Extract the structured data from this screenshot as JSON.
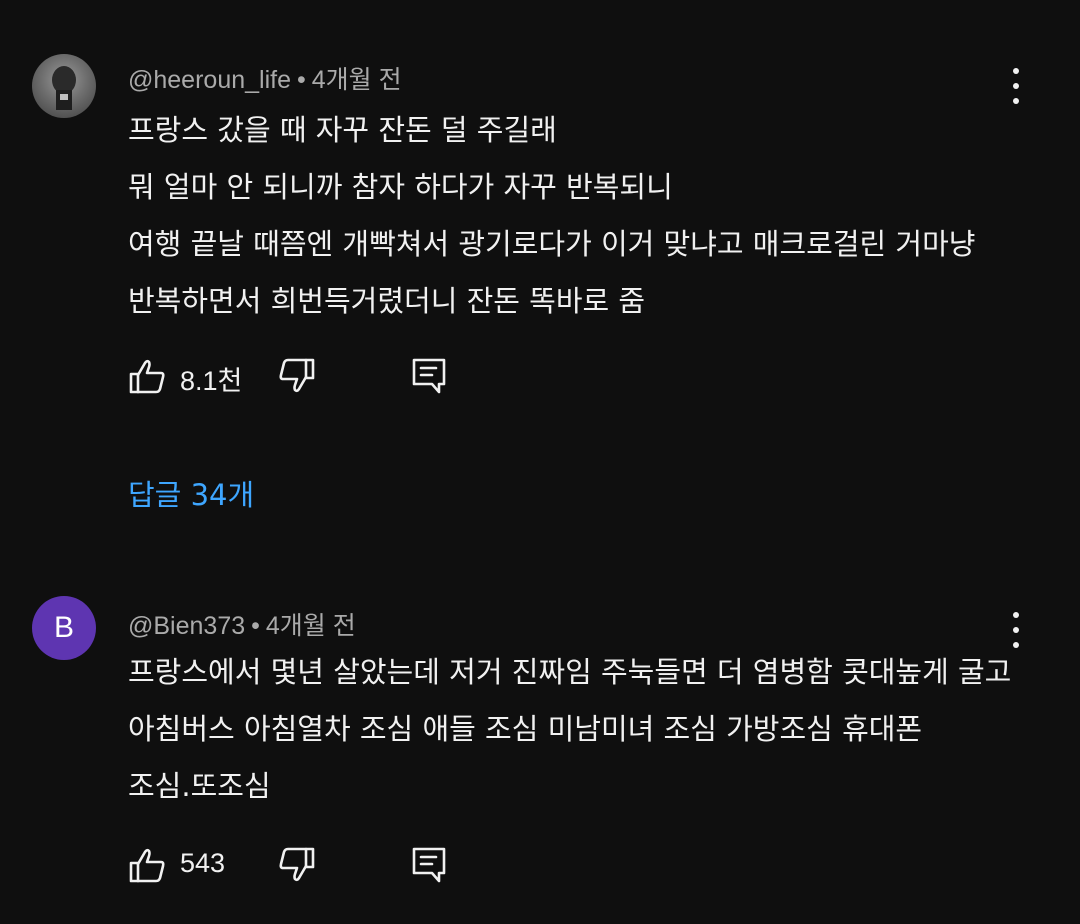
{
  "comments": [
    {
      "avatar": {
        "type": "photo"
      },
      "author": "@heeroun_life",
      "separator": "•",
      "time": "4개월 전",
      "lines": [
        "프랑스 갔을 때 자꾸 잔돈 덜 주길래",
        "뭐 얼마 안 되니까 참자 하다가 자꾸 반복되니",
        "여행 끝날 때쯤엔 개빡쳐서 광기로다가 이거 맞냐고 매크로걸린 거마냥",
        "반복하면서 희번득거렸더니 잔돈 똑바로 줌"
      ],
      "like_count": "8.1천",
      "icons": {
        "like": "thumbs-up-icon",
        "dislike": "thumbs-down-icon",
        "reply": "comment-icon",
        "menu": "more-vert-icon"
      }
    },
    {
      "avatar": {
        "type": "letter",
        "letter": "B",
        "color": "#5e35b1"
      },
      "author": "@Bien373",
      "separator": "•",
      "time": "4개월 전",
      "lines": [
        "프랑스에서 몇년 살았는데 저거 진짜임 주눅들면 더 염병함 콧대높게 굴고",
        "아침버스 아침열차 조심 애들 조심 미남미녀 조심 가방조심 휴대폰",
        "조심.또조심"
      ],
      "like_count": "543",
      "icons": {
        "like": "thumbs-up-icon",
        "dislike": "thumbs-down-icon",
        "reply": "comment-icon",
        "menu": "more-vert-icon"
      }
    }
  ],
  "replies_link": "답글 34개",
  "colors": {
    "background": "#0f0f0f",
    "text": "#f1f1f1",
    "meta": "#aaaaaa",
    "link": "#3ea6ff",
    "avatar_letter_bg": "#5e35b1"
  }
}
